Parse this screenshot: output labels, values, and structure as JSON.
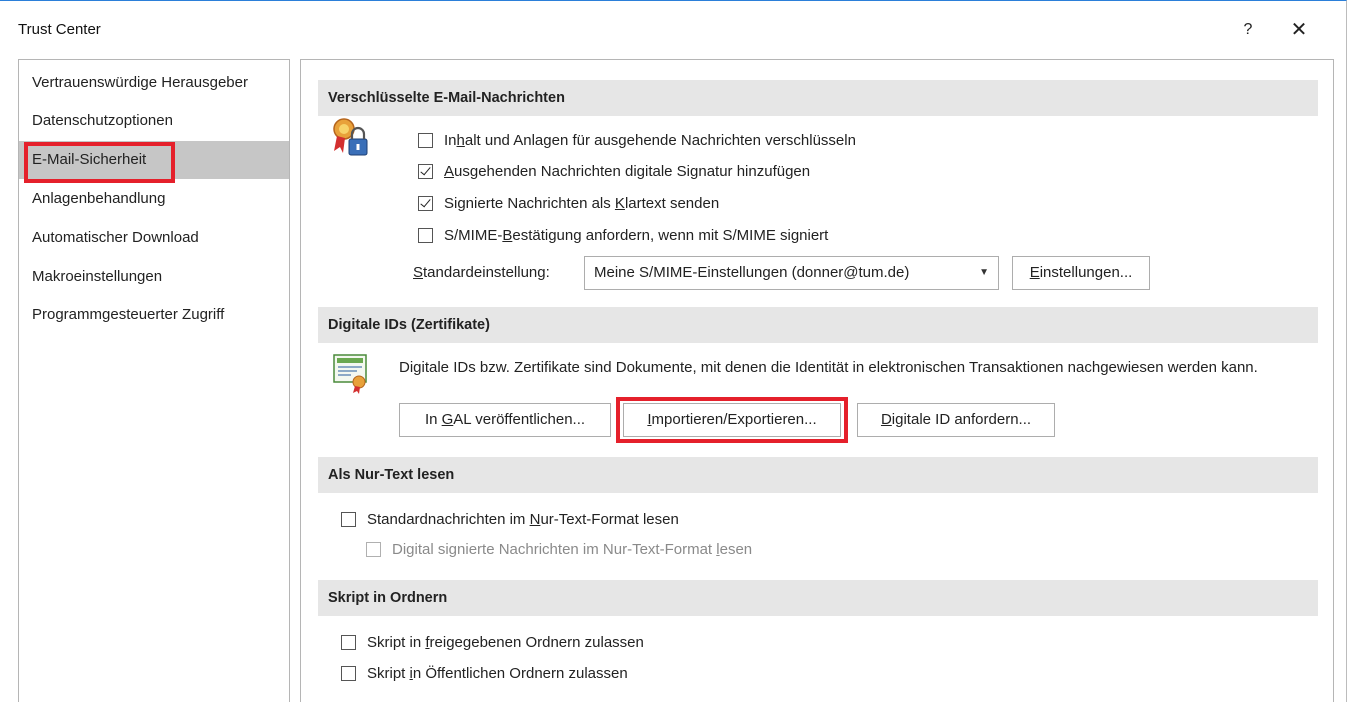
{
  "window": {
    "title": "Trust Center",
    "help": "?",
    "close": "✕"
  },
  "sidebar": {
    "items": [
      {
        "label": "Vertrauenswürdige Herausgeber"
      },
      {
        "label": "Datenschutzoptionen"
      },
      {
        "label": "E-Mail-Sicherheit"
      },
      {
        "label": "Anlagenbehandlung"
      },
      {
        "label": "Automatischer Download"
      },
      {
        "label": "Makroeinstellungen"
      },
      {
        "label": "Programmgesteuerter Zugriff"
      }
    ]
  },
  "encrypted": {
    "header": "Verschlüsselte E-Mail-Nachrichten",
    "options": [
      {
        "pre": "In",
        "key": "h",
        "post": "alt und Anlagen für ausgehende Nachrichten verschlüsseln",
        "checked": false
      },
      {
        "pre": "",
        "key": "A",
        "post": "usgehenden Nachrichten digitale Signatur hinzufügen",
        "checked": true
      },
      {
        "pre": "Signierte Nachrichten als ",
        "key": "K",
        "post": "lartext senden",
        "checked": true
      },
      {
        "pre": "S/MIME-",
        "key": "B",
        "post": "estätigung anfordern, wenn mit S/MIME signiert",
        "checked": false
      }
    ],
    "default_label": {
      "key": "S",
      "post": "tandardeinstellung:"
    },
    "default_value": "Meine S/MIME-Einstellungen (donner@tum.de)",
    "settings_button": {
      "key": "E",
      "post": "instellungen..."
    }
  },
  "digital_ids": {
    "header": "Digitale IDs (Zertifikate)",
    "description": "Digitale IDs bzw. Zertifikate sind Dokumente, mit denen die Identität in elektronischen Transaktionen nachgewiesen werden kann.",
    "publish_button": {
      "pre": "In ",
      "key": "G",
      "post": "AL veröffentlichen..."
    },
    "import_button": {
      "pre": "",
      "key": "I",
      "post": "mportieren/Exportieren..."
    },
    "request_button": {
      "pre": "",
      "key": "D",
      "post": "igitale ID anfordern..."
    }
  },
  "plain_text": {
    "header": "Als Nur-Text lesen",
    "options": [
      {
        "pre": "Standardnachrichten im ",
        "key": "N",
        "post": "ur-Text-Format lesen",
        "checked": false,
        "disabled": false
      },
      {
        "pre": "Digital signierte Nachrichten im Nur-Text-Format ",
        "key": "l",
        "post": "esen",
        "checked": false,
        "disabled": true
      }
    ]
  },
  "scripts": {
    "header": "Skript in Ordnern",
    "options": [
      {
        "pre": "Skript in ",
        "key": "f",
        "post": "reigegebenen Ordnern zulassen",
        "checked": false
      },
      {
        "pre": "Skript ",
        "key": "i",
        "post": "n Öffentlichen Ordnern zulassen",
        "checked": false
      }
    ]
  },
  "colors": {
    "highlight": "#e5202b",
    "selected_bg": "#c6c6c6",
    "section_bg": "#e6e6e6",
    "title_border": "#2b7fd9"
  }
}
